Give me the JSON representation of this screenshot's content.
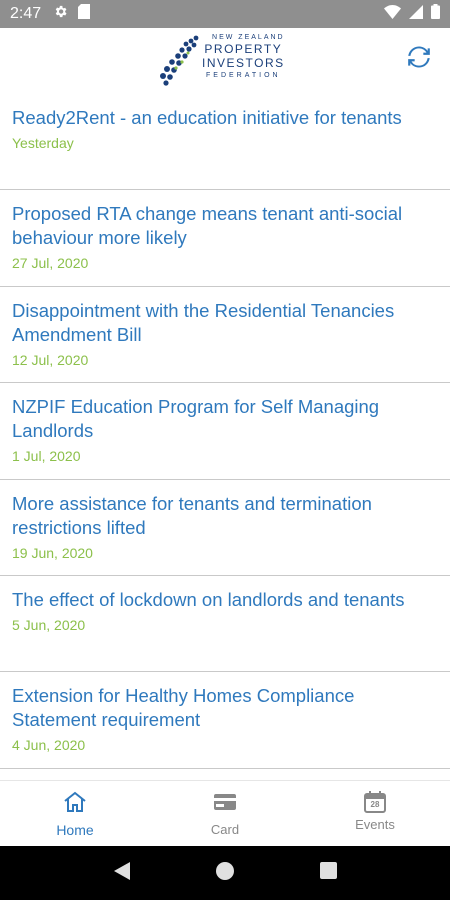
{
  "status_bar": {
    "time": "2:47",
    "icons": [
      "gear-icon",
      "sd-card-icon",
      "wifi-icon",
      "signal-icon",
      "battery-icon"
    ]
  },
  "header": {
    "logo": {
      "line1": "NEW ZEALAND",
      "line2": "PROPERTY",
      "line3": "INVESTORS",
      "line4": "FEDERATION"
    },
    "refresh_icon": "refresh-icon"
  },
  "news": [
    {
      "title": "Ready2Rent - an education initiative for tenants",
      "date": "Yesterday"
    },
    {
      "title": "Proposed RTA change means tenant anti-social behaviour more likely",
      "date": "27 Jul, 2020"
    },
    {
      "title": "Disappointment with the Residential Tenancies Amendment Bill",
      "date": "12 Jul, 2020"
    },
    {
      "title": "NZPIF Education Program for Self Managing Landlords",
      "date": "1 Jul, 2020"
    },
    {
      "title": "More assistance for tenants and termination restrictions lifted",
      "date": "19 Jun, 2020"
    },
    {
      "title": "The effect of lockdown on landlords and tenants",
      "date": "5 Jun, 2020"
    },
    {
      "title": "Extension for Healthy Homes Compliance Statement requirement",
      "date": "4 Jun, 2020"
    }
  ],
  "bottom_nav": {
    "items": [
      {
        "label": "Home",
        "icon": "home-icon",
        "active": true
      },
      {
        "label": "Card",
        "icon": "card-icon",
        "active": false
      },
      {
        "label": "Events",
        "icon": "calendar-icon",
        "active": false,
        "calendar_day": "28"
      }
    ]
  },
  "colors": {
    "title": "#2f79bd",
    "date": "#8cc04b",
    "status_bar": "#8f8f8f",
    "logo": "#1b3f7a"
  }
}
